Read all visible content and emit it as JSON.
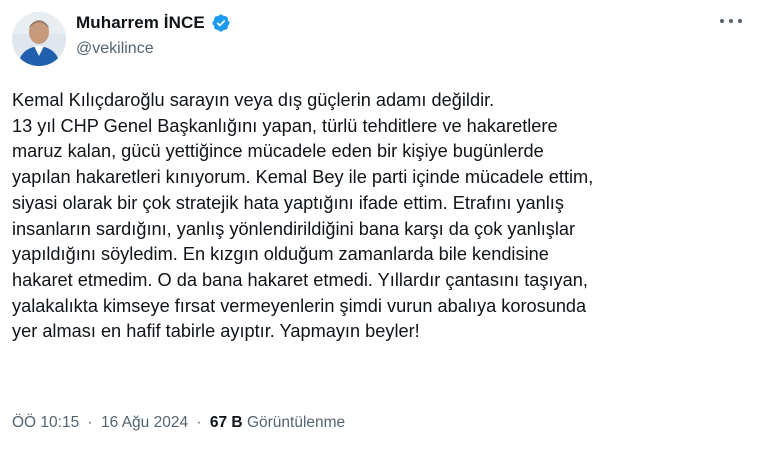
{
  "author": {
    "display_name": "Muharrem İNCE",
    "handle": "@vekilince",
    "verified": true,
    "verified_color": "#1d9bf0"
  },
  "tweet": {
    "lines": [
      "Kemal Kılıçdaroğlu sarayın veya dış güçlerin adamı değildir.",
      "13 yıl CHP Genel Başkanlığını yapan, türlü tehditlere ve  hakaretlere",
      "maruz kalan, gücü yettiğince mücadele eden bir kişiye bugünlerde",
      "yapılan hakaretleri kınıyorum. Kemal Bey ile parti içinde mücadele ettim,",
      "siyasi olarak bir çok stratejik hata yaptığını ifade ettim. Etrafını yanlış",
      "insanların sardığını, yanlış yönlendirildiğini bana karşı da çok yanlışlar",
      "yapıldığını söyledim. En kızgın olduğum zamanlarda bile kendisine",
      "hakaret etmedim. O da bana hakaret etmedi. Yıllardır çantasını taşıyan,",
      "yalakalıkta kimseye fırsat vermeyenlerin şimdi vurun abalıya korosunda",
      "yer alması  en hafif tabirle ayıptır. Yapmayın beyler!"
    ]
  },
  "meta": {
    "time": "ÖÖ 10:15",
    "separator": "·",
    "date": "16 Ağu 2024",
    "views_count": "67 B",
    "views_label": "Görüntülenme"
  },
  "icons": {
    "more": "more-horizontal-icon",
    "verified": "verified-badge-icon"
  }
}
